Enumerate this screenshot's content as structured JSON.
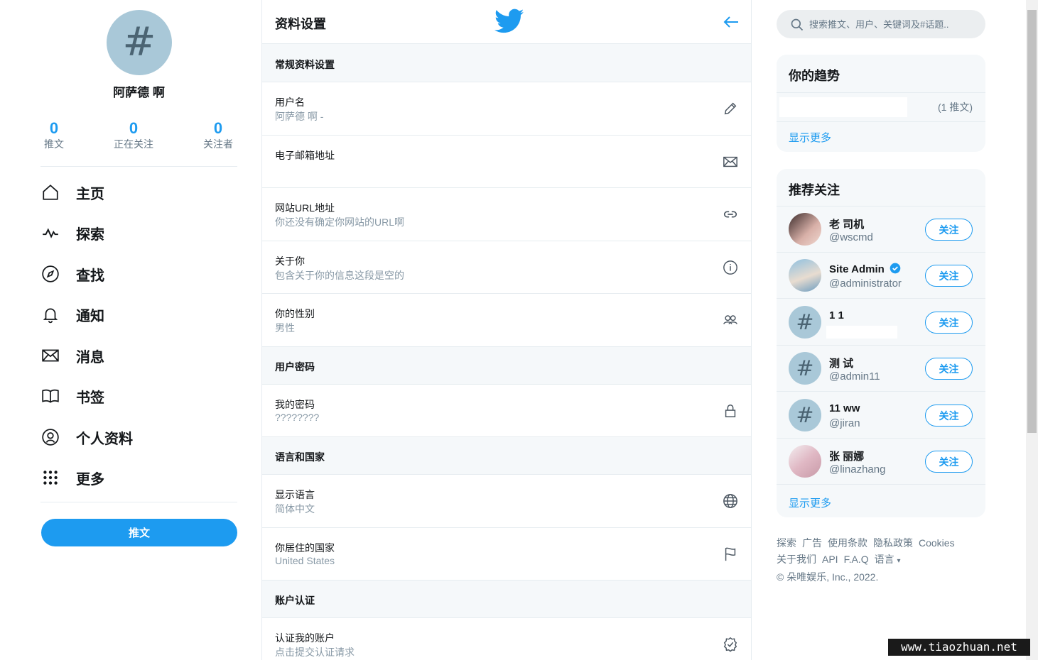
{
  "profile": {
    "avatar_glyph": "#",
    "name": "阿萨德 啊",
    "stats": [
      {
        "value": "0",
        "label": "推文"
      },
      {
        "value": "0",
        "label": "正在关注"
      },
      {
        "value": "0",
        "label": "关注者"
      }
    ]
  },
  "nav": [
    {
      "label": "主页",
      "icon": "home-icon"
    },
    {
      "label": "探索",
      "icon": "pulse-icon"
    },
    {
      "label": "查找",
      "icon": "compass-icon"
    },
    {
      "label": "通知",
      "icon": "bell-icon"
    },
    {
      "label": "消息",
      "icon": "envelope-icon"
    },
    {
      "label": "书签",
      "icon": "book-icon"
    },
    {
      "label": "个人资料",
      "icon": "user-circle-icon"
    },
    {
      "label": "更多",
      "icon": "dots-grid-icon"
    }
  ],
  "tweet_button": "推文",
  "settings": {
    "title": "资料设置",
    "sections": {
      "general": "常规资料设置",
      "password": "用户密码",
      "language": "语言和国家",
      "verify": "账户认证"
    },
    "rows": {
      "username": {
        "label": "用户名",
        "value": "阿萨德 啊 - "
      },
      "email": {
        "label": "电子邮箱地址",
        "value": ""
      },
      "website": {
        "label": "网站URL地址",
        "value": "你还没有确定你网站的URL啊"
      },
      "about": {
        "label": "关于你",
        "value": "包含关于你的信息这段是空的"
      },
      "gender": {
        "label": "你的性别",
        "value": "男性"
      },
      "password": {
        "label": "我的密码",
        "value": "????????"
      },
      "display_language": {
        "label": "显示语言",
        "value": "简体中文"
      },
      "country": {
        "label": "你居住的国家",
        "value": "United States"
      },
      "verify": {
        "label": "认证我的账户",
        "value": "点击提交认证请求"
      }
    }
  },
  "search": {
    "placeholder": "搜索推文、用户、关键词及#话题.."
  },
  "trends": {
    "title": "你的趋势",
    "item_count": "(1 推文)",
    "show_more": "显示更多"
  },
  "suggestions": {
    "title": "推荐关注",
    "follow_label": "关注",
    "show_more": "显示更多",
    "users": [
      {
        "name": "老 司机",
        "handle": "@wscmd",
        "avatar": "photo"
      },
      {
        "name": "Site Admin",
        "handle": "@administrator",
        "avatar": "photo",
        "verified": true
      },
      {
        "name": "1 1",
        "handle": "",
        "avatar": "#"
      },
      {
        "name": "测 试",
        "handle": "@admin11",
        "avatar": "#"
      },
      {
        "name": "11 ww",
        "handle": "@jiran",
        "avatar": "#"
      },
      {
        "name": "张 丽娜",
        "handle": "@linazhang",
        "avatar": "photo"
      }
    ]
  },
  "footer": {
    "links_row1": [
      "探索",
      "广告",
      "使用条款",
      "隐私政策",
      "Cookies"
    ],
    "links_row2": [
      "关于我们",
      "API",
      "F.A.Q",
      "语言"
    ],
    "copyright": "© 朵唯娱乐, Inc., 2022."
  },
  "watermark": "www.tiaozhuan.net",
  "colors": {
    "accent": "#1d9bf0",
    "muted": "#657786",
    "panel": "#f5f8fa"
  }
}
